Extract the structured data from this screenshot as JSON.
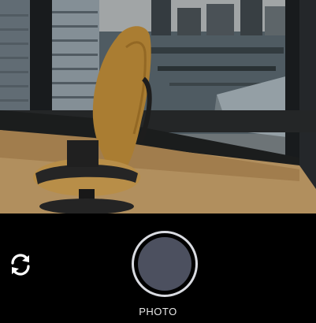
{
  "camera": {
    "mode_label": "PHOTO",
    "icons": {
      "switch_camera": "switch-camera-icon"
    },
    "colors": {
      "background": "#000000",
      "shutter_ring": "#d9dbe1",
      "shutter_fill": "#4c505f",
      "label_text": "#e8e8e8"
    }
  }
}
